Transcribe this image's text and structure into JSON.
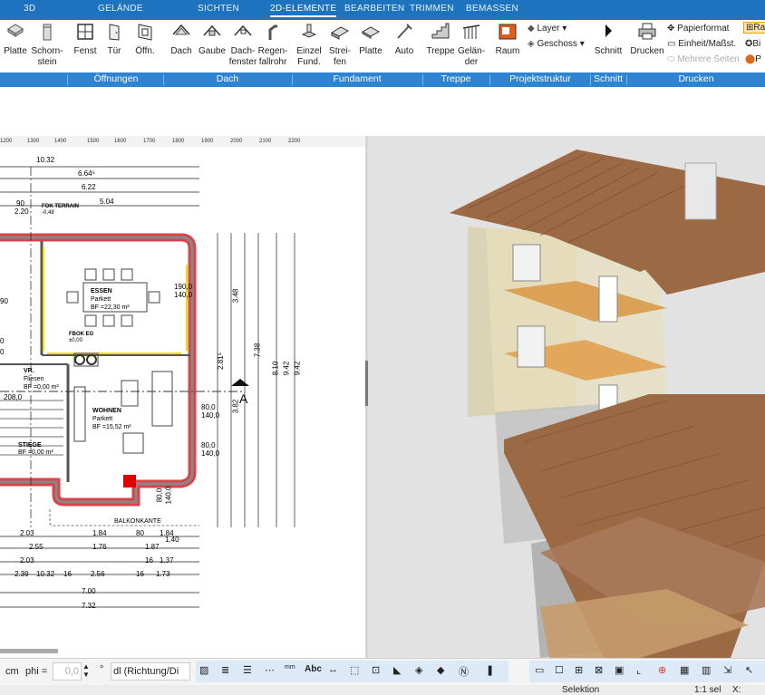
{
  "tabs": [
    "3D",
    "GELÄNDE",
    "SICHTEN",
    "2D-ELEMENTE",
    "BEARBEITEN",
    "TRIMMEN",
    "BEMASSEN"
  ],
  "ribbon": {
    "buttons": [
      {
        "label": "Platte",
        "icon": "slab-icon"
      },
      {
        "label": "Schorn-\nstein",
        "icon": "chimney-icon"
      },
      {
        "label": "Fenst",
        "icon": "window-icon"
      },
      {
        "label": "Tür",
        "icon": "door-icon"
      },
      {
        "label": "Öffn.",
        "icon": "opening-icon"
      },
      {
        "label": "Dach",
        "icon": "roof-icon"
      },
      {
        "label": "Gaube",
        "icon": "dormer-icon"
      },
      {
        "label": "Dach-\nfenster",
        "icon": "roof-window-icon"
      },
      {
        "label": "Regen-\nfallrohr",
        "icon": "downpipe-icon"
      },
      {
        "label": "Einzel\nFund.",
        "icon": "single-foundation-icon"
      },
      {
        "label": "Strei-\nfen",
        "icon": "strip-foundation-icon"
      },
      {
        "label": "Platte",
        "icon": "foundation-slab-icon"
      },
      {
        "label": "Auto",
        "icon": "auto-icon"
      },
      {
        "label": "Treppe",
        "icon": "stair-icon"
      },
      {
        "label": "Gelän-\nder",
        "icon": "railing-icon"
      },
      {
        "label": "Raum",
        "icon": "room-icon"
      },
      {
        "label": "Schnitt",
        "icon": "section-icon"
      },
      {
        "label": "Drucken",
        "icon": "printer-icon"
      }
    ],
    "side_items": {
      "layer": "Layer",
      "geschoss": "Geschoss",
      "papierformat": "Papierformat",
      "einheit": "Einheit/Maßst.",
      "mehrere": "Mehrere Seiten",
      "ra": "Ra",
      "bi": "Bi",
      "p": "P"
    },
    "groups": [
      "Öffnungen",
      "Dach",
      "Fundament",
      "Treppe",
      "Projektstruktur",
      "Schnitt",
      "Drucken"
    ]
  },
  "ruler_ticks": [
    "1200",
    "1300",
    "1400",
    "1500",
    "1600",
    "1700",
    "1800",
    "1900",
    "2000",
    "2100",
    "2200"
  ],
  "plan": {
    "dims_top": [
      "10.32",
      "6.64⁵",
      "6.22",
      "5.04",
      "90",
      "2.20"
    ],
    "fok_terrain": "FOK TERRAIN",
    "fok_terrain_val": "-0,48",
    "room_essen": "ESSEN",
    "essen_floor": "Parkett",
    "essen_area": "BF =22,30 m²",
    "fok_eg": "FBOK EG",
    "fok_eg_val": "±0,00",
    "room_vr": "VR.",
    "vr_floor": "Fliesen",
    "vr_area": "BF =0,00 m²",
    "room_wohnen": "WOHNEN",
    "wohnen_floor": "Parkett",
    "wohnen_area": "BF =15,52 m²",
    "room_stiege": "STIEGE",
    "stiege_area": "BF =0,00 m²",
    "balkonkante": "BALKONKANTE",
    "section_marker": "A",
    "dims_right": [
      "7.38",
      "8.10",
      "9.42",
      "9.42",
      "3.48",
      "2.81⁵",
      "3.82"
    ],
    "dims_small_right": [
      "190,0",
      "140,0",
      "80,0",
      "140,0",
      "80,0",
      "140,0",
      "80,0",
      "140,0"
    ],
    "dims_bottom": [
      "2.03",
      "1.84",
      "80",
      "1.84",
      "2.55",
      "1.76",
      "1.87",
      "1.40",
      "2.03",
      "1.37",
      "2.39",
      "10.32",
      "2.56",
      "1.73",
      "7.00",
      "7.32",
      "16",
      "16",
      "16"
    ],
    "left_vals": [
      "90",
      "0",
      "0",
      "208,0"
    ]
  },
  "bottom_toolbar": {
    "unit": "cm",
    "phi_label": "phi =",
    "phi_value": "0,0",
    "degree": "°",
    "direction": "dl (Richtung/Di"
  },
  "status": {
    "mode": "Selektion",
    "scale": "1:1 sel",
    "x": "X:"
  }
}
